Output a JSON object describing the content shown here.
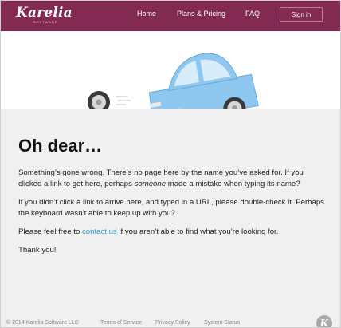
{
  "header": {
    "logo_text": "Karelia",
    "logo_sub": "SOFTWARE",
    "nav": [
      {
        "label": "Home"
      },
      {
        "label": "Plans & Pricing"
      },
      {
        "label": "FAQ"
      }
    ],
    "signin_label": "Sign in"
  },
  "colors": {
    "header_bg": "#832a53",
    "car_body": "#8ec7ef",
    "link": "#2a9ec9"
  },
  "main": {
    "title": "Oh dear…",
    "para1_a": "Something’s gone wrong. There’s no page here by the name you’ve asked for. If you clicked a link to get here, perhaps ",
    "para1_em": "someone",
    "para1_b": " made a mistake when typing its name?",
    "para2": "If you didn’t click a link to arrive here, and typed in a URL, please double-check it. Perhaps the keyboard wasn’t able to keep up with you?",
    "para3_a": "Please feel free to ",
    "para3_link": "contact us",
    "para3_b": " if you aren’t able to find what you’re looking for.",
    "para4": "Thank you!"
  },
  "footer": {
    "copyright": "© 2014 Karelia Software LLC",
    "terms": "Terms of Service",
    "privacy": "Privacy Policy",
    "status": "System Status",
    "logo_letter": "K"
  }
}
